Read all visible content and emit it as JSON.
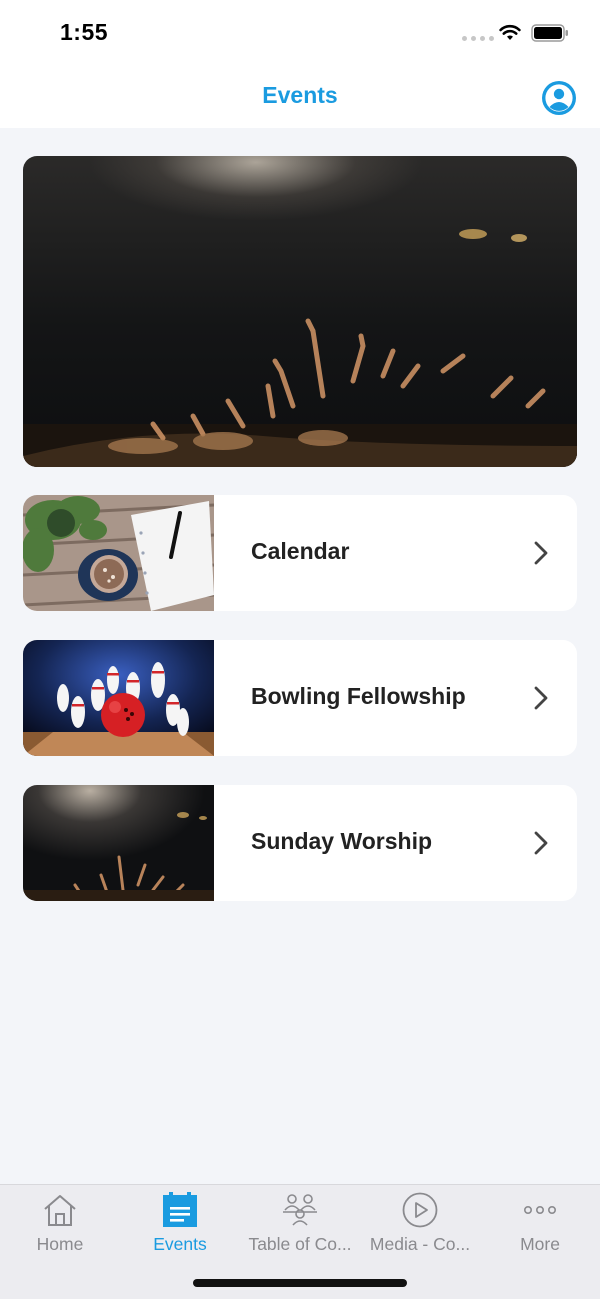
{
  "status_bar": {
    "time": "1:55"
  },
  "nav": {
    "title": "Events"
  },
  "events": [
    {
      "label": "Calendar"
    },
    {
      "label": "Bowling Fellowship"
    },
    {
      "label": "Sunday Worship"
    }
  ],
  "tabs": [
    {
      "label": "Home",
      "icon": "home-icon",
      "active": false
    },
    {
      "label": "Events",
      "icon": "calendar-icon",
      "active": true
    },
    {
      "label": "Table of Co...",
      "icon": "people-group-icon",
      "active": false
    },
    {
      "label": "Media - Co...",
      "icon": "play-circle-icon",
      "active": false
    },
    {
      "label": "More",
      "icon": "more-dots-icon",
      "active": false
    }
  ],
  "colors": {
    "accent": "#1a9be0",
    "background": "#f3f5f9",
    "tab_inactive": "#8a8a8e"
  }
}
